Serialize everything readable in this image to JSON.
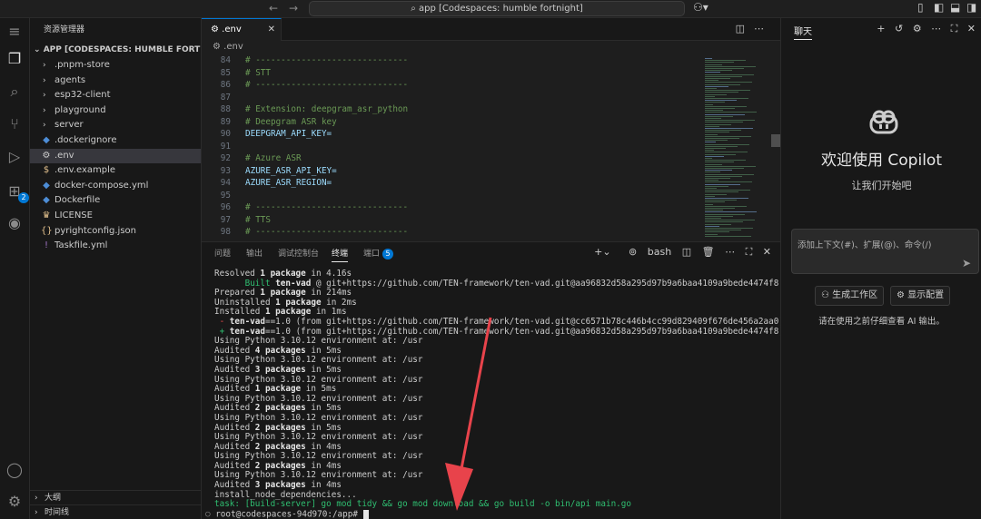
{
  "titlebar": {
    "search_text": "app [Codespaces: humble fortnight]",
    "back": "←",
    "forward": "→",
    "copilot_icon": "copilot-menu-icon"
  },
  "sidebar": {
    "title": "资源管理器",
    "root": "APP [CODESPACES: HUMBLE FORTNIGHT]",
    "items": [
      {
        "label": ".pnpm-store",
        "type": "folder"
      },
      {
        "label": "agents",
        "type": "folder"
      },
      {
        "label": "esp32-client",
        "type": "folder"
      },
      {
        "label": "playground",
        "type": "folder"
      },
      {
        "label": "server",
        "type": "folder"
      },
      {
        "label": ".dockerignore",
        "type": "file",
        "icon": "docker-icon"
      },
      {
        "label": ".env",
        "type": "file",
        "icon": "gear-icon",
        "selected": true
      },
      {
        "label": ".env.example",
        "type": "file",
        "icon": "dollar-icon"
      },
      {
        "label": "docker-compose.yml",
        "type": "file",
        "icon": "docker-icon"
      },
      {
        "label": "Dockerfile",
        "type": "file",
        "icon": "docker-icon"
      },
      {
        "label": "LICENSE",
        "type": "file",
        "icon": "license-icon"
      },
      {
        "label": "pyrightconfig.json",
        "type": "file",
        "icon": "braces-icon"
      },
      {
        "label": "Taskfile.yml",
        "type": "file",
        "icon": "exclamation-icon"
      }
    ],
    "outline": "大纲",
    "timeline": "时间线"
  },
  "activity_badge": "2",
  "editor": {
    "tab_label": ".env",
    "breadcrumb": ".env",
    "lines": [
      {
        "n": "84",
        "t": "# ------------------------------",
        "c": "comment"
      },
      {
        "n": "85",
        "t": "# STT",
        "c": "comment"
      },
      {
        "n": "86",
        "t": "# ------------------------------",
        "c": "comment"
      },
      {
        "n": "87",
        "t": "",
        "c": ""
      },
      {
        "n": "88",
        "t": "# Extension: deepgram_asr_python",
        "c": "comment"
      },
      {
        "n": "89",
        "t": "# Deepgram ASR key",
        "c": "comment"
      },
      {
        "n": "90",
        "t": "DEEPGRAM_API_KEY=",
        "c": "keyname"
      },
      {
        "n": "91",
        "t": "",
        "c": ""
      },
      {
        "n": "92",
        "t": "# Azure ASR",
        "c": "comment"
      },
      {
        "n": "93",
        "t": "AZURE_ASR_API_KEY=",
        "c": "keyname"
      },
      {
        "n": "94",
        "t": "AZURE_ASR_REGION=",
        "c": "keyname"
      },
      {
        "n": "95",
        "t": "",
        "c": ""
      },
      {
        "n": "96",
        "t": "# ------------------------------",
        "c": "comment"
      },
      {
        "n": "97",
        "t": "# TTS",
        "c": "comment"
      },
      {
        "n": "98",
        "t": "# ------------------------------",
        "c": "comment"
      }
    ]
  },
  "panel": {
    "tabs": [
      "问题",
      "输出",
      "调试控制台",
      "终端",
      "端口"
    ],
    "active_tab": "终端",
    "ports_badge": "5",
    "shell": "bash",
    "terminal": [
      [
        {
          "t": "Resolved "
        },
        {
          "t": "1 package",
          "s": "b"
        },
        {
          "t": " in 4.16s"
        }
      ],
      [
        {
          "t": "      "
        },
        {
          "t": "Built",
          "s": "g"
        },
        {
          "t": " ten-vad",
          "s": "b"
        },
        {
          "t": " @ git+https://github.com/TEN-framework/ten-vad.git@aa96832d58a295d97b9a6baa4109a9bede4474f8"
        }
      ],
      [
        {
          "t": "Prepared "
        },
        {
          "t": "1 package",
          "s": "b"
        },
        {
          "t": " in 214ms"
        }
      ],
      [
        {
          "t": "Uninstalled "
        },
        {
          "t": "1 package",
          "s": "b"
        },
        {
          "t": " in 2ms"
        }
      ],
      [
        {
          "t": "Installed "
        },
        {
          "t": "1 package",
          "s": "b"
        },
        {
          "t": " in 1ms"
        }
      ],
      [
        {
          "t": " - ",
          "s": "r"
        },
        {
          "t": "ten-vad",
          "s": "b"
        },
        {
          "t": "==1.0 (from git+https://github.com/TEN-framework/ten-vad.git@cc6571b78c446b4cc99d829409f676de456a2aa0)"
        }
      ],
      [
        {
          "t": " + ",
          "s": "g"
        },
        {
          "t": "ten-vad",
          "s": "b"
        },
        {
          "t": "==1.0 (from git+https://github.com/TEN-framework/ten-vad.git@aa96832d58a295d97b9a6baa4109a9bede4474f8)"
        }
      ],
      [
        {
          "t": "Using Python 3.10.12 environment at: /usr"
        }
      ],
      [
        {
          "t": "Audited "
        },
        {
          "t": "4 packages",
          "s": "b"
        },
        {
          "t": " in 5ms"
        }
      ],
      [
        {
          "t": "Using Python 3.10.12 environment at: /usr"
        }
      ],
      [
        {
          "t": "Audited "
        },
        {
          "t": "3 packages",
          "s": "b"
        },
        {
          "t": " in 5ms"
        }
      ],
      [
        {
          "t": "Using Python 3.10.12 environment at: /usr"
        }
      ],
      [
        {
          "t": "Audited "
        },
        {
          "t": "1 package",
          "s": "b"
        },
        {
          "t": " in 5ms"
        }
      ],
      [
        {
          "t": "Using Python 3.10.12 environment at: /usr"
        }
      ],
      [
        {
          "t": "Audited "
        },
        {
          "t": "2 packages",
          "s": "b"
        },
        {
          "t": " in 5ms"
        }
      ],
      [
        {
          "t": "Using Python 3.10.12 environment at: /usr"
        }
      ],
      [
        {
          "t": "Audited "
        },
        {
          "t": "2 packages",
          "s": "b"
        },
        {
          "t": " in 5ms"
        }
      ],
      [
        {
          "t": "Using Python 3.10.12 environment at: /usr"
        }
      ],
      [
        {
          "t": "Audited "
        },
        {
          "t": "2 packages",
          "s": "b"
        },
        {
          "t": " in 4ms"
        }
      ],
      [
        {
          "t": "Using Python 3.10.12 environment at: /usr"
        }
      ],
      [
        {
          "t": "Audited "
        },
        {
          "t": "2 packages",
          "s": "b"
        },
        {
          "t": " in 4ms"
        }
      ],
      [
        {
          "t": "Using Python 3.10.12 environment at: /usr"
        }
      ],
      [
        {
          "t": "Audited "
        },
        {
          "t": "3 packages",
          "s": "b"
        },
        {
          "t": " in 4ms"
        }
      ],
      [
        {
          "t": "install_node_dependencies..."
        }
      ],
      [
        {
          "t": "task: [build-server] go mod tidy && go mod download && go build -o bin/api main.go",
          "s": "task"
        }
      ]
    ],
    "prompt": "root@codespaces-94d970:/app# "
  },
  "chat": {
    "title": "聊天",
    "welcome": "欢迎使用 Copilot",
    "subtitle": "让我们开始吧",
    "input_placeholder": "添加上下文(#)、扩展(@)、命令(/)",
    "btn_workspace": "生成工作区",
    "btn_config": "显示配置",
    "note": "请在使用之前仔细查看 AI 输出。"
  },
  "colors": {
    "accent": "#0078d4",
    "annotation_arrow": "#e8434b",
    "terminal_green": "#2fbf71"
  }
}
